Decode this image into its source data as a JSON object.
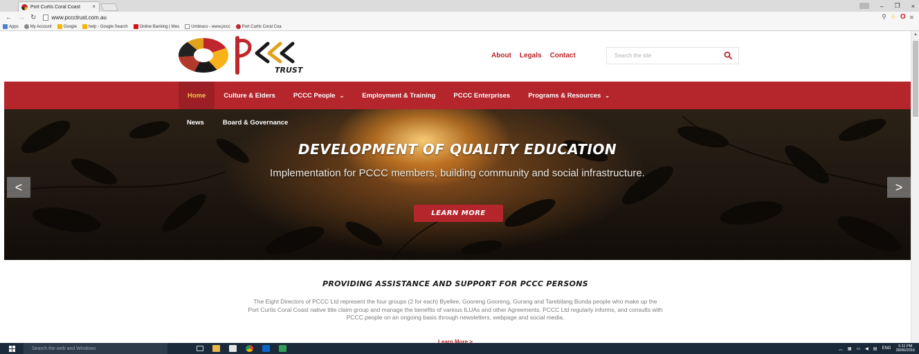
{
  "browser": {
    "tab_title": "Port Curtis Coral Coast",
    "tab_close": "×",
    "url": "www.pccctrust.com.au",
    "bookmarks": [
      {
        "label": "Apps",
        "color": "#4a7fd1"
      },
      {
        "label": "My Account",
        "color": "#888888"
      },
      {
        "label": "Google",
        "color": "#f4b400"
      },
      {
        "label": "help - Google Search",
        "color": "#f4b400"
      },
      {
        "label": "Online Banking | Wes",
        "color": "#d2131b"
      },
      {
        "label": "Umbraco - www.pccc",
        "color": "#888888"
      },
      {
        "label": "Port Curtis Coral Coa",
        "color": "#c0272d"
      }
    ],
    "window_controls": {
      "minimize": "–",
      "restore": "❐",
      "close": "×"
    }
  },
  "header": {
    "logo_main": "PCCC",
    "logo_sub": "TRUST",
    "links": [
      "About",
      "Legals",
      "Contact"
    ],
    "search_placeholder": "Search the site"
  },
  "nav": {
    "items": [
      {
        "label": "Home",
        "active": true,
        "dropdown": false
      },
      {
        "label": "Culture & Elders",
        "active": false,
        "dropdown": false
      },
      {
        "label": "PCCC People",
        "active": false,
        "dropdown": true
      },
      {
        "label": "Employment & Training",
        "active": false,
        "dropdown": false
      },
      {
        "label": "PCCC Enterprises",
        "active": false,
        "dropdown": false
      },
      {
        "label": "Programs & Resources",
        "active": false,
        "dropdown": true
      }
    ],
    "sub_items": [
      "News",
      "Board & Governance"
    ]
  },
  "hero": {
    "title": "DEVELOPMENT OF QUALITY EDUCATION",
    "subtitle": "Implementation for PCCC members, building community and social infrastructure.",
    "button": "LEARN MORE",
    "prev": "<",
    "next": ">"
  },
  "intro": {
    "title": "PROVIDING ASSISTANCE AND SUPPORT FOR PCCC PERSONS",
    "text": "The Eight Directors of PCCC Ltd represent the four groups (2 for each) Byellee, Gooreng Gooreng, Gurang and Tarebilang Bunda people who make up the Port Curtis Coral Coast native title claim group and manage the benefits of various ILUAs and other Agreements. PCCC Ltd regularly informs, and consults with PCCC people on an ongoing basis through newsletters, webpage and social media.",
    "more": "Learn More >"
  },
  "taskbar": {
    "search_placeholder": "Search the web and Windows",
    "lang": "ENG",
    "time": "5:11 PM",
    "date": "28/06/2016"
  },
  "colors": {
    "brand_red": "#b4262c",
    "active_gold": "#f6c84a"
  }
}
